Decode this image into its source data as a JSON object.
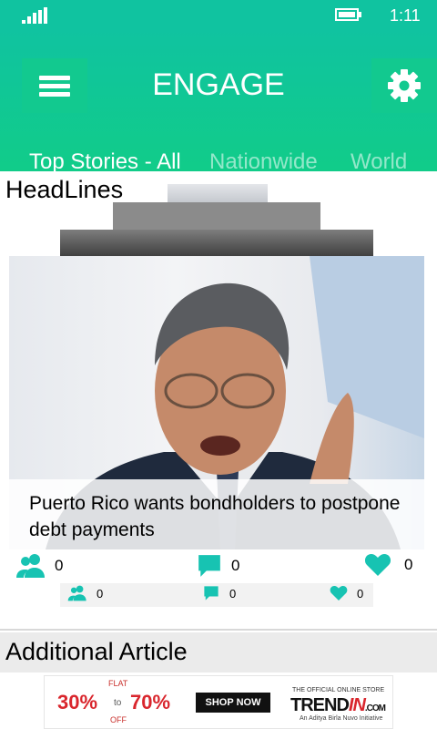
{
  "status_bar": {
    "time": "1:11"
  },
  "header": {
    "title": "ENGAGE"
  },
  "tabs": [
    {
      "label": "Top Stories - All",
      "active": true
    },
    {
      "label": "Nationwide",
      "active": false
    },
    {
      "label": "World",
      "active": false
    }
  ],
  "headlines": {
    "heading": "HeadLines",
    "card": {
      "caption": "Puerto Rico wants bondholders to postpone debt payments",
      "users_count": "0",
      "comments_count": "0",
      "likes_count": "0"
    },
    "back_card": {
      "users_count": "0",
      "comments_count": "0",
      "likes_count": "0"
    }
  },
  "additional": {
    "heading": "Additional Article",
    "ad": {
      "flat": "FLAT",
      "discount_from": "30%",
      "to": "to",
      "discount_to": "70%",
      "off": "OFF",
      "cta": "SHOP NOW",
      "store_tagline": "THE OFFICIAL ONLINE STORE",
      "brand_prefix": "TREND",
      "brand_accent": "IN",
      "brand_suffix": ".COM",
      "initiative": "An Aditya Birla Nuvo Initiative"
    }
  },
  "colors": {
    "accent": "#10c3a0",
    "icon": "#17c3b2"
  },
  "icons": {
    "users": "users-icon",
    "comments": "comment-icon",
    "likes": "heart-icon",
    "menu": "menu-icon",
    "settings": "gear-icon"
  }
}
